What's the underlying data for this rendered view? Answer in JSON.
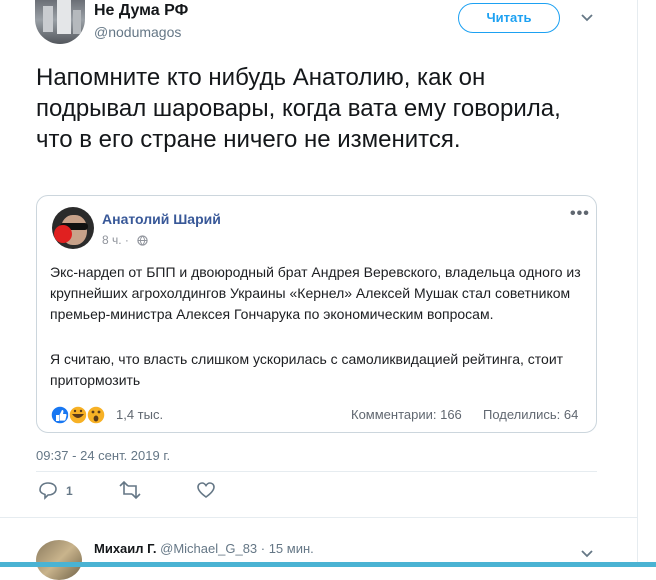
{
  "author": {
    "name": "Не Дума РФ",
    "handle": "@nodumagos"
  },
  "follow_label": "Читать",
  "tweet_text": "Напомните кто нибудь Анатолию, как он подрывал шаровары, когда вата ему говорила, что в его стране ничего не изменится.",
  "fb_post": {
    "author": "Анатолий Шарий",
    "time": "8 ч. ·",
    "paragraph1": "Экс-нардеп от БПП и двоюродный брат Андрея Веревского, владельца одного из крупнейших агрохолдингов Украины «Кернел» Алексей Мушак стал советником премьер-министра Алексея Гончарука по экономическим вопросам.",
    "paragraph2": "Я считаю, что власть слишком ускорилась с самоликвидацией рейтинга, стоит притормозить",
    "reaction_count": "1,4 тыс.",
    "comments": "Комментарии: 166",
    "shares": "Поделились: 64",
    "more": "•••"
  },
  "timestamp": "09:37 - 24 сент. 2019 г.",
  "actions": {
    "reply_count": "1"
  },
  "reply": {
    "name": "Михаил Г.",
    "handle": "@Michael_G_83 · 15 мин."
  },
  "colors": {
    "accent": "#1da1f2",
    "fb_name": "#385898",
    "muted": "#657786"
  }
}
